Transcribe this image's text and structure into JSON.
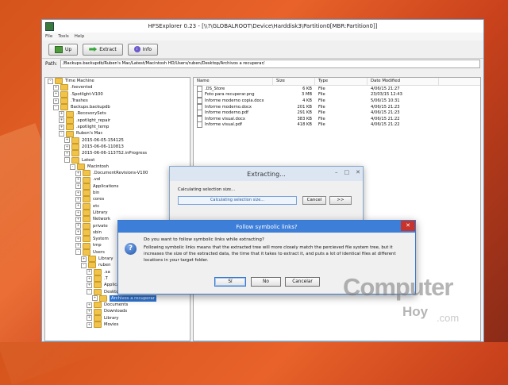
{
  "window": {
    "title": "HFSExplorer 0.23 - [\\\\?\\GLOBALROOT\\Device\\Harddisk3\\Partition0[MBR:Partition0]]",
    "menu": [
      "File",
      "Tools",
      "Help"
    ],
    "toolbar": {
      "up_label": "Up",
      "extract_label": "Extract",
      "info_label": "Info"
    },
    "path_label": "Path:",
    "path_value": "/Backups.backupdb/Ruben's Mac/Latest/Macintosh HD/Users/ruben/Desktop/Archivos a recuperar/"
  },
  "tree": [
    {
      "label": "Time Machine",
      "depth": 0,
      "toggle": "-"
    },
    {
      "label": ".fseventsd",
      "depth": 1,
      "toggle": "+"
    },
    {
      "label": ".Spotlight-V100",
      "depth": 1,
      "toggle": "+"
    },
    {
      "label": ".Trashes",
      "depth": 1,
      "toggle": "+"
    },
    {
      "label": "Backups.backupdb",
      "depth": 1,
      "toggle": "-"
    },
    {
      "label": ".RecoverySets",
      "depth": 2,
      "toggle": "+"
    },
    {
      "label": ".spotlight_repair",
      "depth": 2,
      "toggle": "+"
    },
    {
      "label": ".spotlight_temp",
      "depth": 2,
      "toggle": "+"
    },
    {
      "label": "Ruben's Mac",
      "depth": 2,
      "toggle": "-"
    },
    {
      "label": "2015-06-05-154125",
      "depth": 3,
      "toggle": "+"
    },
    {
      "label": "2015-06-06-110813",
      "depth": 3,
      "toggle": "+"
    },
    {
      "label": "2015-06-06-113752.inProgress",
      "depth": 3,
      "toggle": "+"
    },
    {
      "label": "Latest",
      "depth": 3,
      "toggle": "-"
    },
    {
      "label": "Macintosh",
      "depth": 4,
      "toggle": "-"
    },
    {
      "label": ".DocumentRevisions-V100",
      "depth": 5,
      "toggle": "+"
    },
    {
      "label": ".vol",
      "depth": 5,
      "toggle": "+"
    },
    {
      "label": "Applications",
      "depth": 5,
      "toggle": "+"
    },
    {
      "label": "bin",
      "depth": 5,
      "toggle": "+"
    },
    {
      "label": "cores",
      "depth": 5,
      "toggle": "+"
    },
    {
      "label": "etc",
      "depth": 5,
      "toggle": "+"
    },
    {
      "label": "Library",
      "depth": 5,
      "toggle": "+"
    },
    {
      "label": "Network",
      "depth": 5,
      "toggle": "+"
    },
    {
      "label": "private",
      "depth": 5,
      "toggle": "+"
    },
    {
      "label": "sbin",
      "depth": 5,
      "toggle": "+"
    },
    {
      "label": "System",
      "depth": 5,
      "toggle": "+"
    },
    {
      "label": "tmp",
      "depth": 5,
      "toggle": "+"
    },
    {
      "label": "Users",
      "depth": 5,
      "toggle": "-"
    },
    {
      "label": "Library",
      "depth": 6,
      "toggle": "+"
    },
    {
      "label": "ruben",
      "depth": 6,
      "toggle": "-"
    },
    {
      "label": ".sa",
      "depth": 7,
      "toggle": "+"
    },
    {
      "label": ".T",
      "depth": 7,
      "toggle": "+"
    },
    {
      "label": "Applications",
      "depth": 7,
      "toggle": "+"
    },
    {
      "label": "Desktop",
      "depth": 7,
      "toggle": "-"
    },
    {
      "label": "Archivos a recuperar",
      "depth": 8,
      "toggle": "+",
      "selected": true
    },
    {
      "label": "Documents",
      "depth": 7,
      "toggle": "+"
    },
    {
      "label": "Downloads",
      "depth": 7,
      "toggle": "+"
    },
    {
      "label": "Library",
      "depth": 7,
      "toggle": "+"
    },
    {
      "label": "Movies",
      "depth": 7,
      "toggle": "+"
    }
  ],
  "file_list": {
    "columns": [
      "Name",
      "Size",
      "Type",
      "Date Modified"
    ],
    "rows": [
      {
        "name": ".DS_Store",
        "size": "6 KB",
        "type": "File",
        "date": "4/06/15 21:27"
      },
      {
        "name": "Foto para recuperar.png",
        "size": "3 MB",
        "type": "File",
        "date": "23/03/15 12:43"
      },
      {
        "name": "Informe moderno copia.docx",
        "size": "4 KB",
        "type": "File",
        "date": "5/06/15 10:31"
      },
      {
        "name": "Informe moderno.docx",
        "size": "201 KB",
        "type": "File",
        "date": "4/06/15 21:23"
      },
      {
        "name": "Informe moderno.pdf",
        "size": "291 KB",
        "type": "File",
        "date": "4/06/15 21:23"
      },
      {
        "name": "Informe visual.docx",
        "size": "383 KB",
        "type": "File",
        "date": "4/06/15 21:22"
      },
      {
        "name": "Informe visual.pdf",
        "size": "418 KB",
        "type": "File",
        "date": "4/06/15 21:22"
      }
    ]
  },
  "extract_dialog": {
    "title": "Extracting...",
    "status": "Calculating selection size...",
    "progress_text": "Calculating selection size...",
    "progress": 0.0,
    "cancel_label": "Cancel",
    "more_label": ">>"
  },
  "symlink_dialog": {
    "title": "Follow symbolic links?",
    "question": "Do you want to follow symbolic links while extracting?",
    "explanation": "Following symbolic links means that the extracted tree will more closely match the percieved file system tree, but it increases the size of the extracted data, the time that it takes to extract it, and puts a lot of identical files at different locations in your target folder.",
    "yes_label": "Sí",
    "no_label": "No",
    "cancel_label": "Cancelar"
  },
  "watermark": {
    "line1": "Computer",
    "line2": "Hoy",
    "line3": ".com"
  }
}
